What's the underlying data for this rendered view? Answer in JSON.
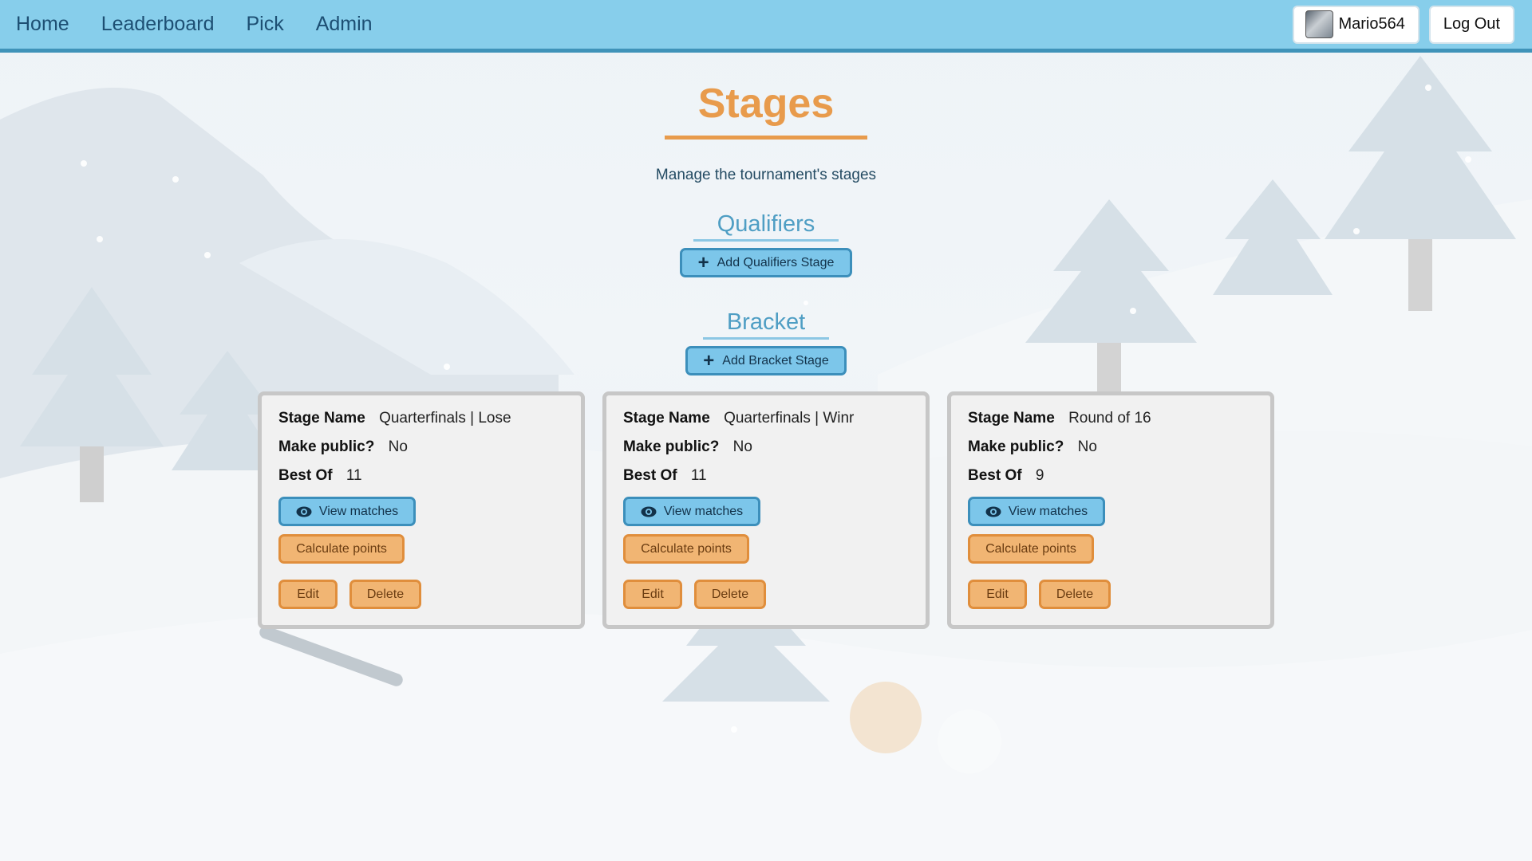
{
  "nav": {
    "links": [
      "Home",
      "Leaderboard",
      "Pick",
      "Admin"
    ],
    "username": "Mario564",
    "logout_label": "Log Out"
  },
  "page": {
    "title": "Stages",
    "subtitle": "Manage the tournament's stages"
  },
  "qualifiers": {
    "title": "Qualifiers",
    "add_label": "Add Qualifiers Stage"
  },
  "bracket": {
    "title": "Bracket",
    "add_label": "Add Bracket Stage"
  },
  "labels": {
    "stage_name": "Stage Name",
    "make_public": "Make public?",
    "best_of": "Best Of",
    "view_matches": "View matches",
    "calculate_points": "Calculate points",
    "edit": "Edit",
    "delete": "Delete"
  },
  "stages": [
    {
      "name": "Quarterfinals | Lose",
      "public": "No",
      "best_of": "11"
    },
    {
      "name": "Quarterfinals | Winr",
      "public": "No",
      "best_of": "11"
    },
    {
      "name": "Round of 16",
      "public": "No",
      "best_of": "9"
    }
  ],
  "colors": {
    "navbar": "#87ceeb",
    "accent_orange": "#e89b4c",
    "accent_blue": "#4f9ec4",
    "button_blue": "#7cc6ea",
    "button_orange": "#f1b573"
  },
  "icons": [
    "plus-icon",
    "eye-icon"
  ]
}
